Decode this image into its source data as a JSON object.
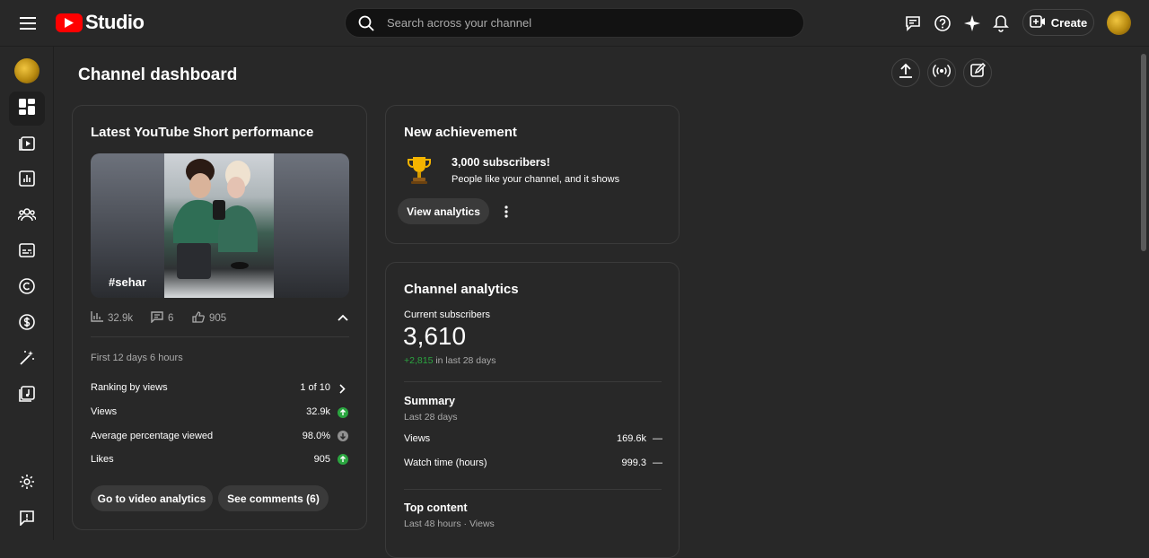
{
  "header": {
    "logo_text": "Studio",
    "search_placeholder": "Search across your channel",
    "create_label": "Create"
  },
  "page": {
    "title": "Channel dashboard"
  },
  "short_card": {
    "title": "Latest YouTube Short performance",
    "hashtag": "#sehar",
    "views": "32.9k",
    "comments": "6",
    "likes": "905",
    "period": "First 12 days 6 hours",
    "rows": [
      {
        "label": "Ranking by views",
        "value": "1 of 10"
      },
      {
        "label": "Views",
        "value": "32.9k"
      },
      {
        "label": "Average percentage viewed",
        "value": "98.0%"
      },
      {
        "label": "Likes",
        "value": "905"
      }
    ],
    "btn_analytics": "Go to video analytics",
    "btn_comments": "See comments (6)"
  },
  "achievement_card": {
    "title": "New achievement",
    "headline": "3,000 subscribers!",
    "subtext": "People like your channel, and it shows",
    "btn_label": "View analytics"
  },
  "analytics_card": {
    "title": "Channel analytics",
    "subs_label": "Current subscribers",
    "subs_value": "3,610",
    "subs_change": "+2,815",
    "subs_change_suffix": "in last 28 days",
    "summary_title": "Summary",
    "summary_period": "Last 28 days",
    "summary_rows": [
      {
        "label": "Views",
        "value": "169.6k",
        "trend": "—"
      },
      {
        "label": "Watch time (hours)",
        "value": "999.3",
        "trend": "—"
      }
    ],
    "top_title": "Top content",
    "top_period": "Last 48 hours · Views"
  },
  "colors": {
    "accent_red": "#ff0000",
    "up_green": "#2ba640",
    "change_green": "#2ba640"
  }
}
